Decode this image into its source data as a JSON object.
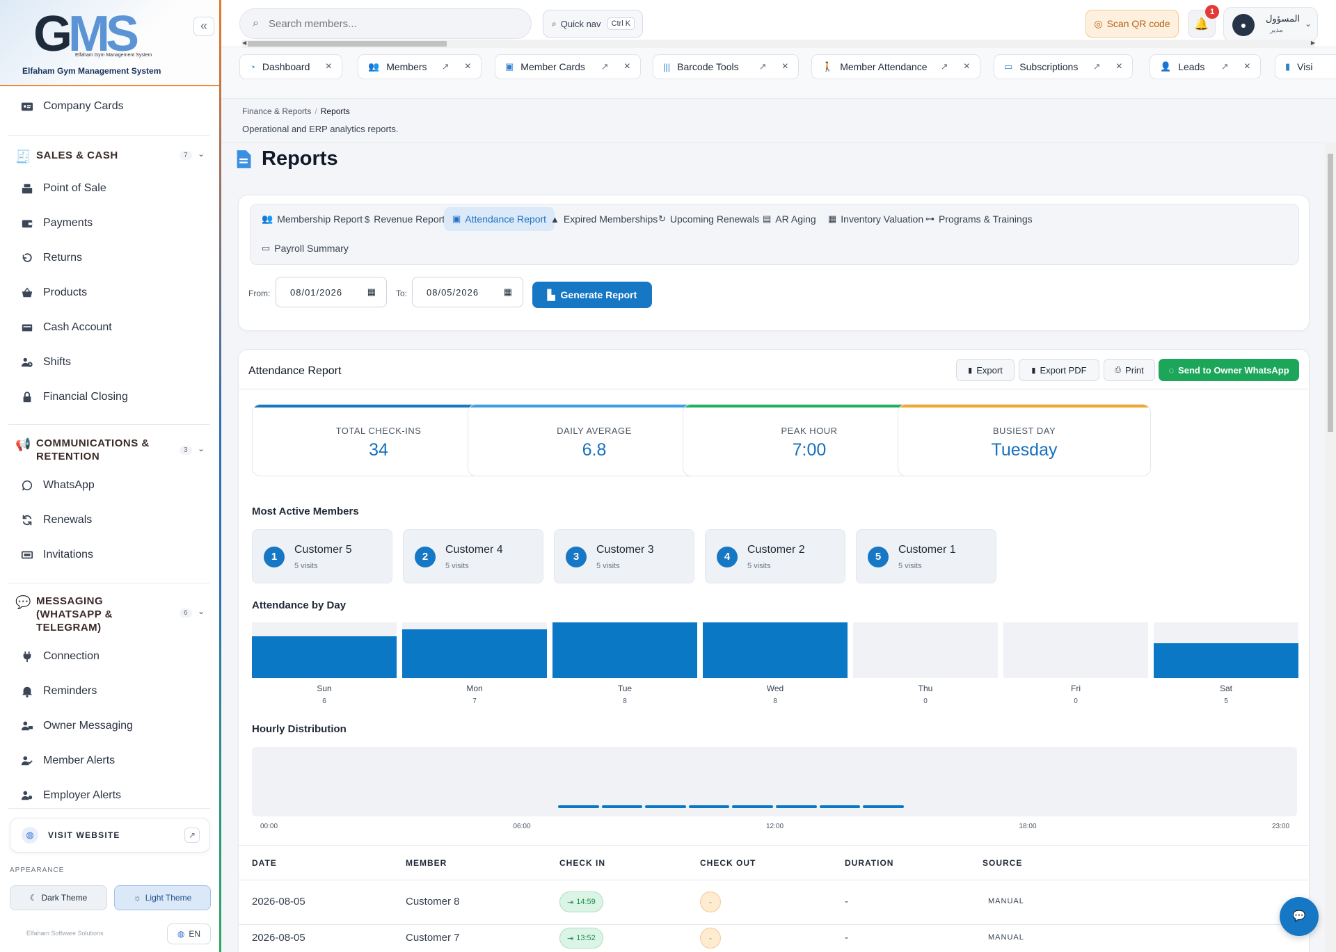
{
  "brand": {
    "logo_text": "GMS",
    "logo_tagline": "Elfaham Gym Management System",
    "name": "Elfaham Gym Management System"
  },
  "sidebar": {
    "top_item": {
      "label": "Company Cards",
      "icon": "id-card-icon"
    },
    "sections": [
      {
        "title": "SALES & CASH",
        "count": "7",
        "icon": "cash-register-icon"
      },
      {
        "title": "COMMUNICATIONS & RETENTION",
        "count": "3",
        "icon": "megaphone-icon"
      },
      {
        "title": "MESSAGING (WHATSAPP & TELEGRAM)",
        "count": "6",
        "icon": "chat-bubbles-icon"
      }
    ],
    "sales_items": [
      {
        "label": "Point of Sale",
        "icon": "register-icon"
      },
      {
        "label": "Payments",
        "icon": "wallet-icon"
      },
      {
        "label": "Returns",
        "icon": "undo-icon"
      },
      {
        "label": "Products",
        "icon": "basket-icon"
      },
      {
        "label": "Cash Account",
        "icon": "cash-icon"
      },
      {
        "label": "Shifts",
        "icon": "clock-user-icon"
      },
      {
        "label": "Financial Closing",
        "icon": "lock-icon"
      }
    ],
    "comm_items": [
      {
        "label": "WhatsApp",
        "icon": "whatsapp-icon"
      },
      {
        "label": "Renewals",
        "icon": "refresh-icon"
      },
      {
        "label": "Invitations",
        "icon": "ticket-icon"
      }
    ],
    "msg_items": [
      {
        "label": "Connection",
        "icon": "plug-icon"
      },
      {
        "label": "Reminders",
        "icon": "bell-icon"
      },
      {
        "label": "Owner Messaging",
        "icon": "user-chat-icon"
      },
      {
        "label": "Member Alerts",
        "icon": "user-check-icon"
      },
      {
        "label": "Employer Alerts",
        "icon": "user-alert-icon"
      }
    ],
    "visit_website": "VISIT WEBSITE",
    "appearance_label": "APPEARANCE",
    "dark_theme": "Dark Theme",
    "light_theme": "Light Theme",
    "footer": "Elfaham Software Solutions",
    "lang": "EN"
  },
  "topbar": {
    "search_placeholder": "Search members...",
    "quick_nav": "Quick nav",
    "quick_nav_kbd": "Ctrl K",
    "scan_qr": "Scan QR code",
    "notif_count": "1",
    "user_name": "المسؤول",
    "user_role": "مدير"
  },
  "tabs": [
    {
      "label": "Dashboard",
      "icon": "gauge-icon"
    },
    {
      "label": "Members",
      "icon": "users-icon"
    },
    {
      "label": "Member Cards",
      "icon": "id-card-icon"
    },
    {
      "label": "Barcode Tools",
      "icon": "barcode-icon"
    },
    {
      "label": "Member Attendance",
      "icon": "walking-icon"
    },
    {
      "label": "Subscriptions",
      "icon": "card-icon"
    },
    {
      "label": "Leads",
      "icon": "user-plus-icon"
    },
    {
      "label": "Visi",
      "icon": "door-icon"
    }
  ],
  "page": {
    "breadcrumb_parent": "Finance & Reports",
    "breadcrumb_current": "Reports",
    "description": "Operational and ERP analytics reports.",
    "title": "Reports"
  },
  "report_tabs": [
    {
      "label": "Membership Report",
      "icon": "users-icon",
      "glyph": "👥"
    },
    {
      "label": "Revenue Report",
      "icon": "dollar-icon",
      "glyph": "$"
    },
    {
      "label": "Attendance Report",
      "icon": "calendar-check-icon",
      "glyph": "▣"
    },
    {
      "label": "Expired Memberships",
      "icon": "warning-icon",
      "glyph": "▲"
    },
    {
      "label": "Upcoming Renewals",
      "icon": "refresh-icon",
      "glyph": "↻"
    },
    {
      "label": "AR Aging",
      "icon": "file-invoice-icon",
      "glyph": "▤"
    },
    {
      "label": "Inventory Valuation",
      "icon": "boxes-icon",
      "glyph": "▦"
    },
    {
      "label": "Programs & Trainings",
      "icon": "dumbbell-icon",
      "glyph": "⊶"
    },
    {
      "label": "Payroll Summary",
      "icon": "money-card-icon",
      "glyph": "▭"
    }
  ],
  "filters": {
    "from_label": "From:",
    "from_value": "08/01/2026",
    "to_label": "To:",
    "to_value": "08/05/2026",
    "generate": "Generate Report"
  },
  "report": {
    "title": "Attendance Report",
    "export": "Export",
    "export_pdf": "Export PDF",
    "print": "Print",
    "whatsapp": "Send to Owner WhatsApp",
    "stats": [
      {
        "label": "TOTAL CHECK-INS",
        "value": "34",
        "color": "#1677c4"
      },
      {
        "label": "DAILY AVERAGE",
        "value": "6.8",
        "color": "#3aa0e8"
      },
      {
        "label": "PEAK HOUR",
        "value": "7:00",
        "color": "#1fb35f"
      },
      {
        "label": "BUSIEST DAY",
        "value": "Tuesday",
        "color": "#f5a623"
      }
    ],
    "most_active_title": "Most Active Members",
    "members": [
      {
        "rank": "1",
        "name": "Customer 5",
        "visits": "5 visits"
      },
      {
        "rank": "2",
        "name": "Customer 4",
        "visits": "5 visits"
      },
      {
        "rank": "3",
        "name": "Customer 3",
        "visits": "5 visits"
      },
      {
        "rank": "4",
        "name": "Customer 2",
        "visits": "5 visits"
      },
      {
        "rank": "5",
        "name": "Customer 1",
        "visits": "5 visits"
      }
    ],
    "by_day_title": "Attendance by Day",
    "hourly_title": "Hourly Distribution",
    "hourly_ticks": [
      "00:00",
      "06:00",
      "12:00",
      "18:00",
      "23:00"
    ]
  },
  "chart_data": [
    {
      "type": "bar",
      "title": "Attendance by Day",
      "categories": [
        "Sun",
        "Mon",
        "Tue",
        "Wed",
        "Thu",
        "Fri",
        "Sat"
      ],
      "values": [
        6,
        7,
        8,
        8,
        0,
        0,
        5
      ],
      "ylim": [
        0,
        8
      ]
    },
    {
      "type": "bar",
      "title": "Hourly Distribution",
      "x": [
        "00:00",
        "06:00",
        "12:00",
        "18:00",
        "23:00"
      ],
      "hour_range": [
        0,
        23
      ],
      "nonzero_hours": [
        7,
        8,
        9,
        10,
        11,
        12,
        13,
        14
      ]
    }
  ],
  "table": {
    "headers": [
      "DATE",
      "MEMBER",
      "CHECK IN",
      "CHECK OUT",
      "DURATION",
      "SOURCE"
    ],
    "rows": [
      {
        "date": "2026-08-05",
        "member": "Customer 8",
        "check_in": "14:59",
        "check_out": "-",
        "duration": "-",
        "source": "MANUAL"
      },
      {
        "date": "2026-08-05",
        "member": "Customer 7",
        "check_in": "13:52",
        "check_out": "-",
        "duration": "-",
        "source": "MANUAL"
      }
    ]
  }
}
